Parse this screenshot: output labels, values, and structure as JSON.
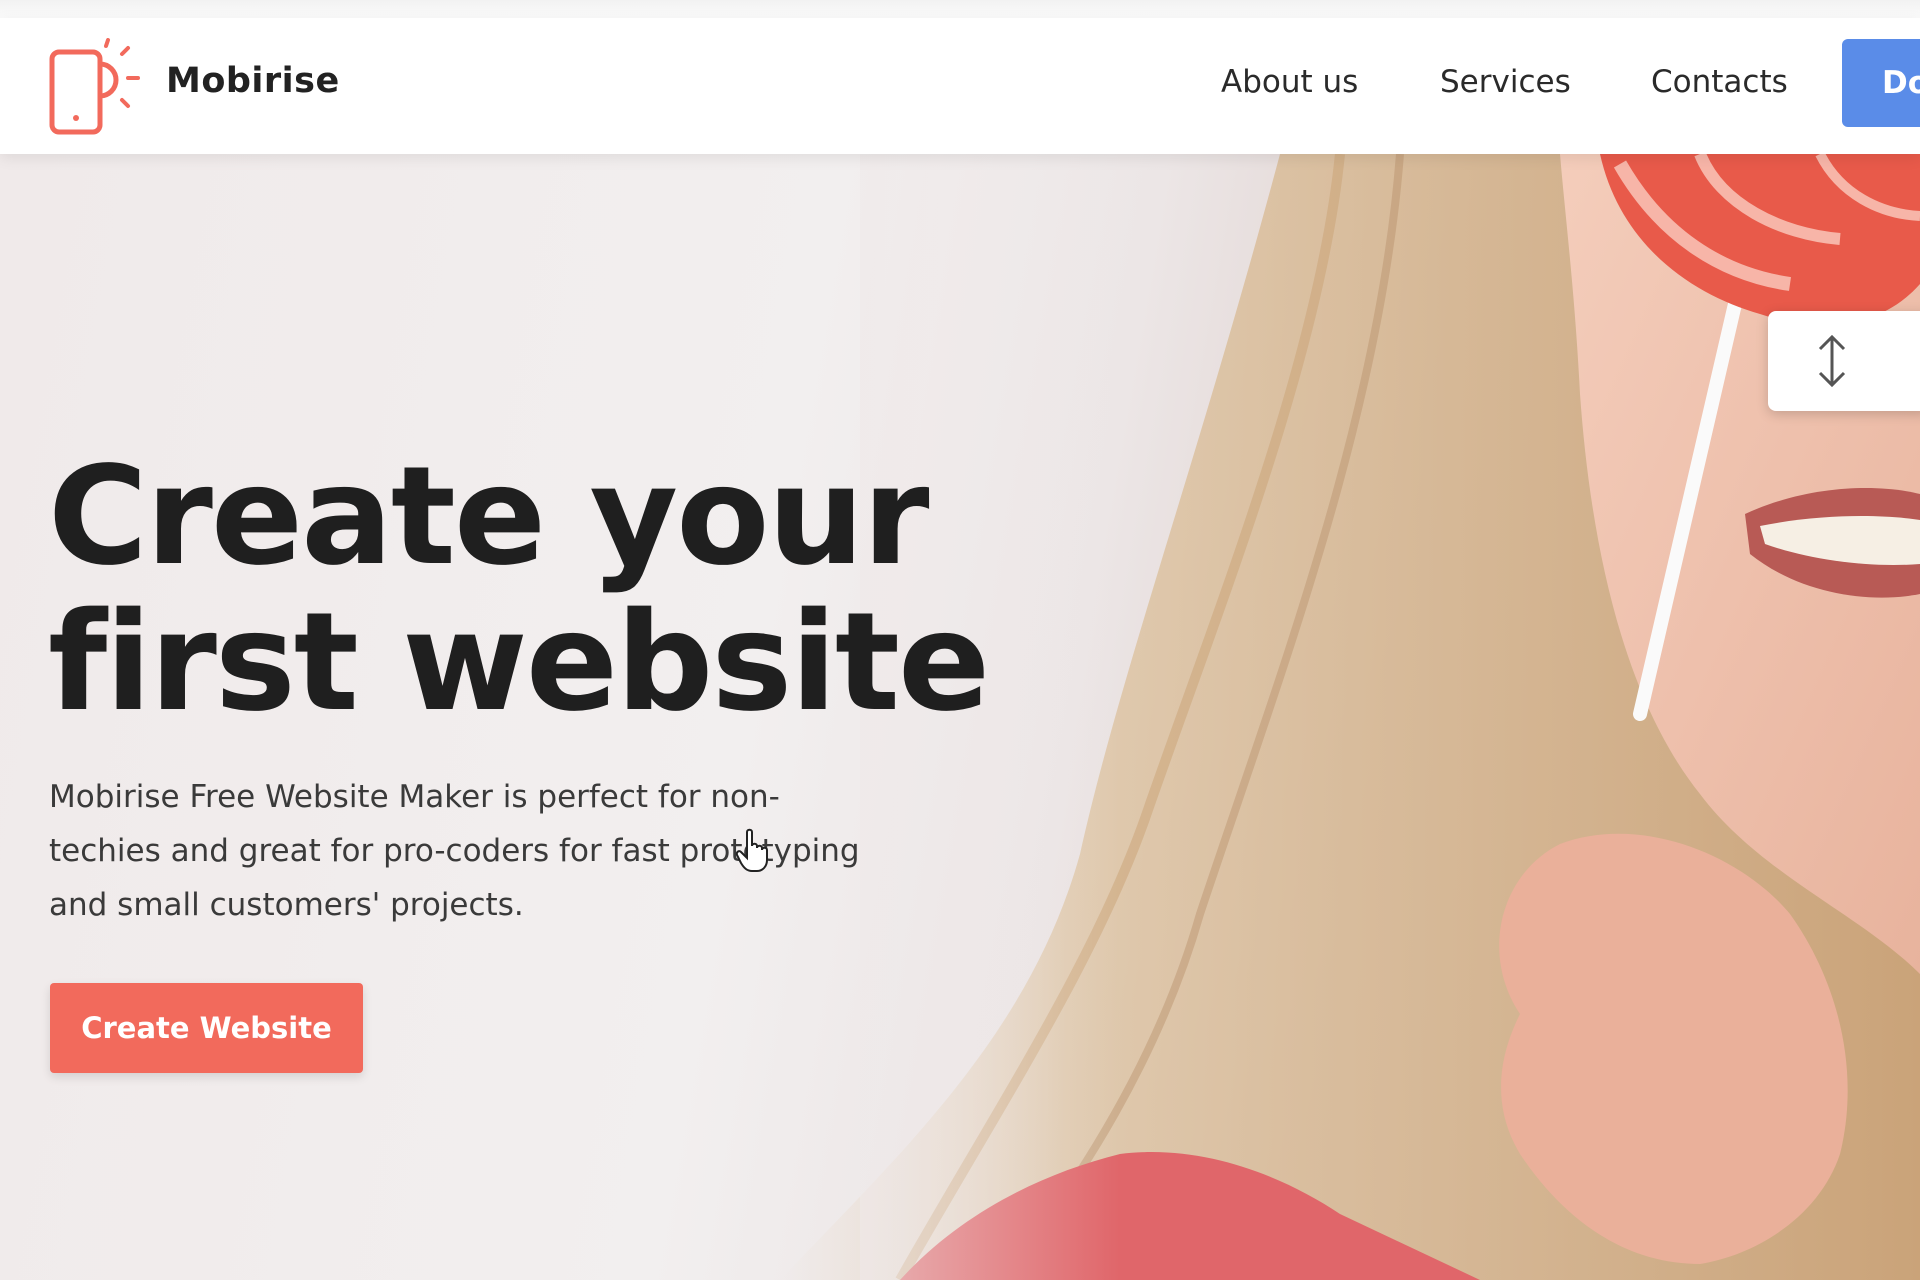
{
  "brand": {
    "name": "Mobirise",
    "logo_icon": "phone-sun-icon",
    "logo_color": "#f26a5c"
  },
  "nav": {
    "links": [
      "About us",
      "Services",
      "Contacts"
    ],
    "cta_label": "Do",
    "cta_color": "#5a8ce8"
  },
  "hero": {
    "title_line1": "Create your",
    "title_line2": "first website",
    "description": "Mobirise Free Website Maker is perfect for non-techies and great for pro-coders for fast prototyping and small customers' projects.",
    "button_label": "Create Website",
    "button_color": "#f26a5c",
    "resize_handle_icon": "vertical-resize-arrows-icon",
    "cursor_icon": "pointer-hand-cursor-icon"
  }
}
